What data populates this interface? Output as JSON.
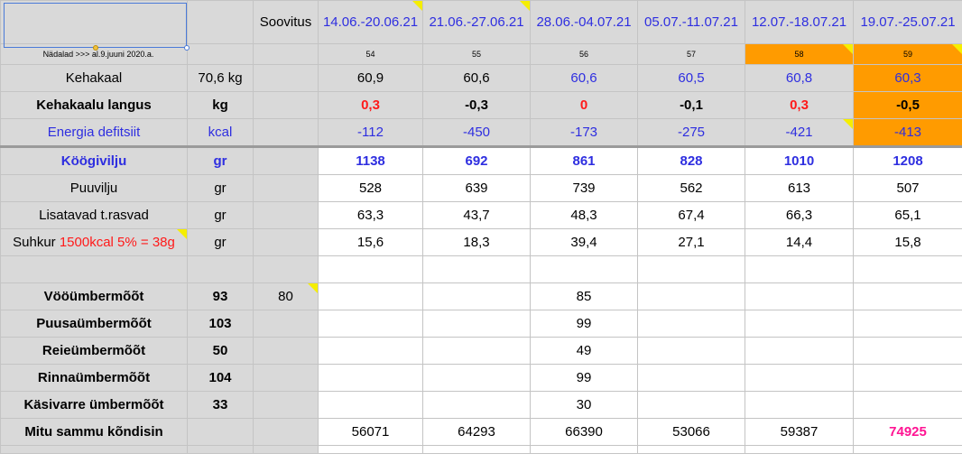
{
  "header": {
    "soovitus": "Soovitus",
    "weeks": [
      "14.06.-20.06.21",
      "21.06.-27.06.21",
      "28.06.-04.07.21",
      "05.07.-11.07.21",
      "12.07.-18.07.21",
      "19.07.-25.07.21"
    ]
  },
  "week_row": {
    "label": "Nädalad >>> al.9.juuni 2020.a.",
    "numbers": [
      "54",
      "55",
      "56",
      "57",
      "58",
      "59"
    ]
  },
  "rows": {
    "kehakaal": {
      "label": "Kehakaal",
      "unit": "70,6 kg",
      "values": [
        "60,9",
        "60,6",
        "60,6",
        "60,5",
        "60,8",
        "60,3"
      ]
    },
    "langus": {
      "label": "Kehakaalu langus",
      "unit": "kg",
      "values": [
        "0,3",
        "-0,3",
        "0",
        "-0,1",
        "0,3",
        "-0,5"
      ]
    },
    "energia": {
      "label": "Energia defitsiit",
      "unit": "kcal",
      "values": [
        "-112",
        "-450",
        "-173",
        "-275",
        "-421",
        "-413"
      ]
    },
    "koogivilju": {
      "label": "Köögivilju",
      "unit": "gr",
      "values": [
        "1138",
        "692",
        "861",
        "828",
        "1010",
        "1208"
      ]
    },
    "puuvilju": {
      "label": "Puuvilju",
      "unit": "gr",
      "values": [
        "528",
        "639",
        "739",
        "562",
        "613",
        "507"
      ]
    },
    "rasvad": {
      "label": "Lisatavad t.rasvad",
      "unit": "gr",
      "values": [
        "63,3",
        "43,7",
        "48,3",
        "67,4",
        "66,3",
        "65,1"
      ]
    },
    "suhkur": {
      "label": "Suhkur",
      "label_note": "1500kcal 5% = 38g",
      "unit": "gr",
      "values": [
        "15,6",
        "18,3",
        "39,4",
        "27,1",
        "14,4",
        "15,8"
      ]
    },
    "voo": {
      "label": "Vööümbermõõt",
      "unit": "93",
      "soovitus": "80",
      "values": [
        "",
        "",
        "85",
        "",
        "",
        ""
      ]
    },
    "puusa": {
      "label": "Puusaümbermõõt",
      "unit": "103",
      "values": [
        "",
        "",
        "99",
        "",
        "",
        ""
      ]
    },
    "reie": {
      "label": "Reieümbermõõt",
      "unit": "50",
      "values": [
        "",
        "",
        "49",
        "",
        "",
        ""
      ]
    },
    "rinna": {
      "label": "Rinnaümbermõõt",
      "unit": "104",
      "values": [
        "",
        "",
        "99",
        "",
        "",
        ""
      ]
    },
    "kasivarre": {
      "label": "Käsivarre ümbermõõt",
      "unit": "33",
      "values": [
        "",
        "",
        "30",
        "",
        "",
        ""
      ]
    },
    "sammud": {
      "label": "Mitu sammu kõndisin",
      "unit": "",
      "values": [
        "56071",
        "64293",
        "66390",
        "53066",
        "59387",
        "74925"
      ]
    }
  },
  "colors": {
    "header_gray": "#d9d9d9",
    "highlight_orange": "#ff9b00",
    "week_blue": "#2e2ee0",
    "negative_red": "#ff1a1a",
    "record_pink": "#ff1493",
    "comment_yellow": "#f5ee00"
  }
}
